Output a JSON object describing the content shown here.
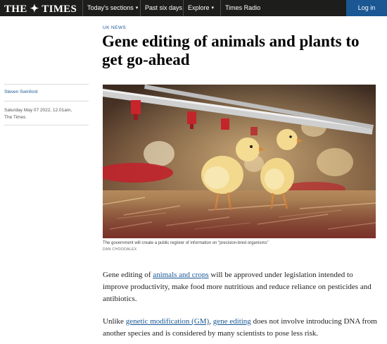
{
  "nav": {
    "logo": "THE ✦ TIMES",
    "items": [
      "Today's sections",
      "Past six days",
      "Explore",
      "Times Radio"
    ],
    "login": "Log in"
  },
  "article": {
    "kicker": "UK NEWS",
    "headline": "Gene editing of animals and plants to get go-ahead",
    "author": "Steven Swinford",
    "date": "Saturday May 07 2022, 12.01am,",
    "publication": "The Times",
    "caption": "The government will create a public register of information on “precision-bred organisms”",
    "credit": "DAN CHOODALEX",
    "p1": {
      "t1": "Gene editing of ",
      "link1": "animals and crops",
      "t2": " will be approved under legislation intended to improve productivity, make food more nutritious and reduce reliance on pesticides and antibiotics."
    },
    "p2": {
      "t1": "Unlike ",
      "link1": "genetic modification (GM)",
      "t2": ", ",
      "link2": "gene editing",
      "t3": " does not involve introducing DNA from another species and is considered by many scientists to pose less risk."
    }
  },
  "colors": {
    "nav_bg": "#1d1d1b",
    "accent": "#1a5793"
  }
}
